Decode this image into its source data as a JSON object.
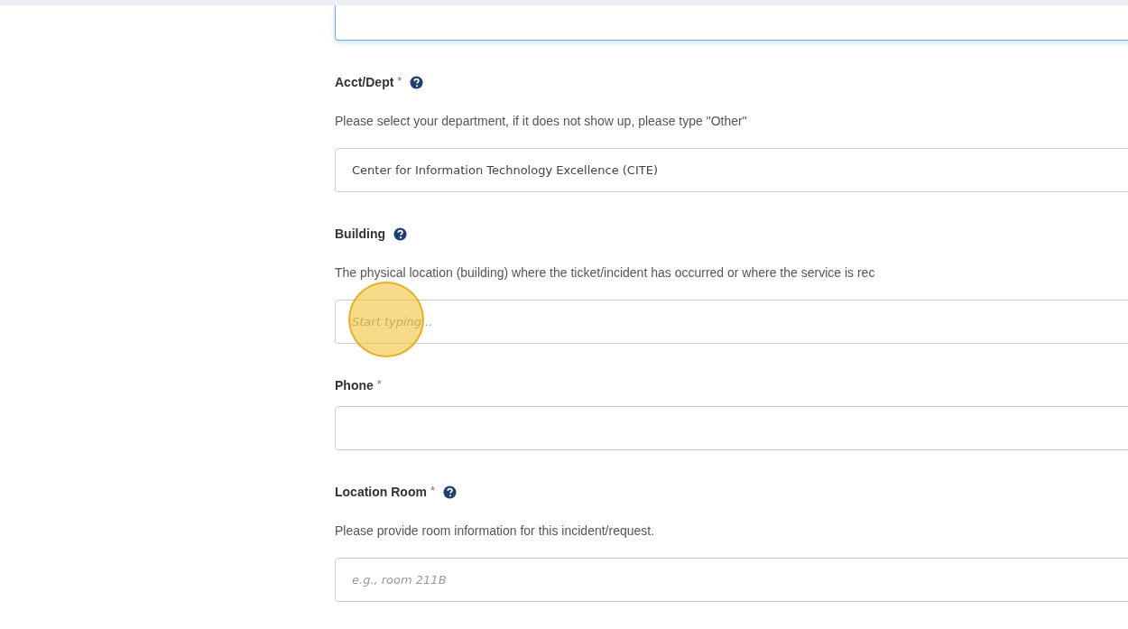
{
  "top_field": {
    "focused": true
  },
  "fields": [
    {
      "label": "Acct/Dept",
      "required_mark": "*",
      "help_icon": true,
      "description": "Please select your department, if it does not show up, please type \"Other\"",
      "value": "Center for Information Technology Excellence (CITE)"
    },
    {
      "label": "Building",
      "help_icon": true,
      "description": "The physical location (building) where the ticket/incident has occurred or where the service is rec",
      "placeholder": "Start typing...",
      "highlighted": true
    },
    {
      "label": "Phone",
      "required_mark": "*"
    },
    {
      "label": "Location Room",
      "required_mark": "*",
      "help_icon": true,
      "description": "Please provide room information for this incident/request.",
      "placeholder": "e.g., room 211B"
    }
  ]
}
